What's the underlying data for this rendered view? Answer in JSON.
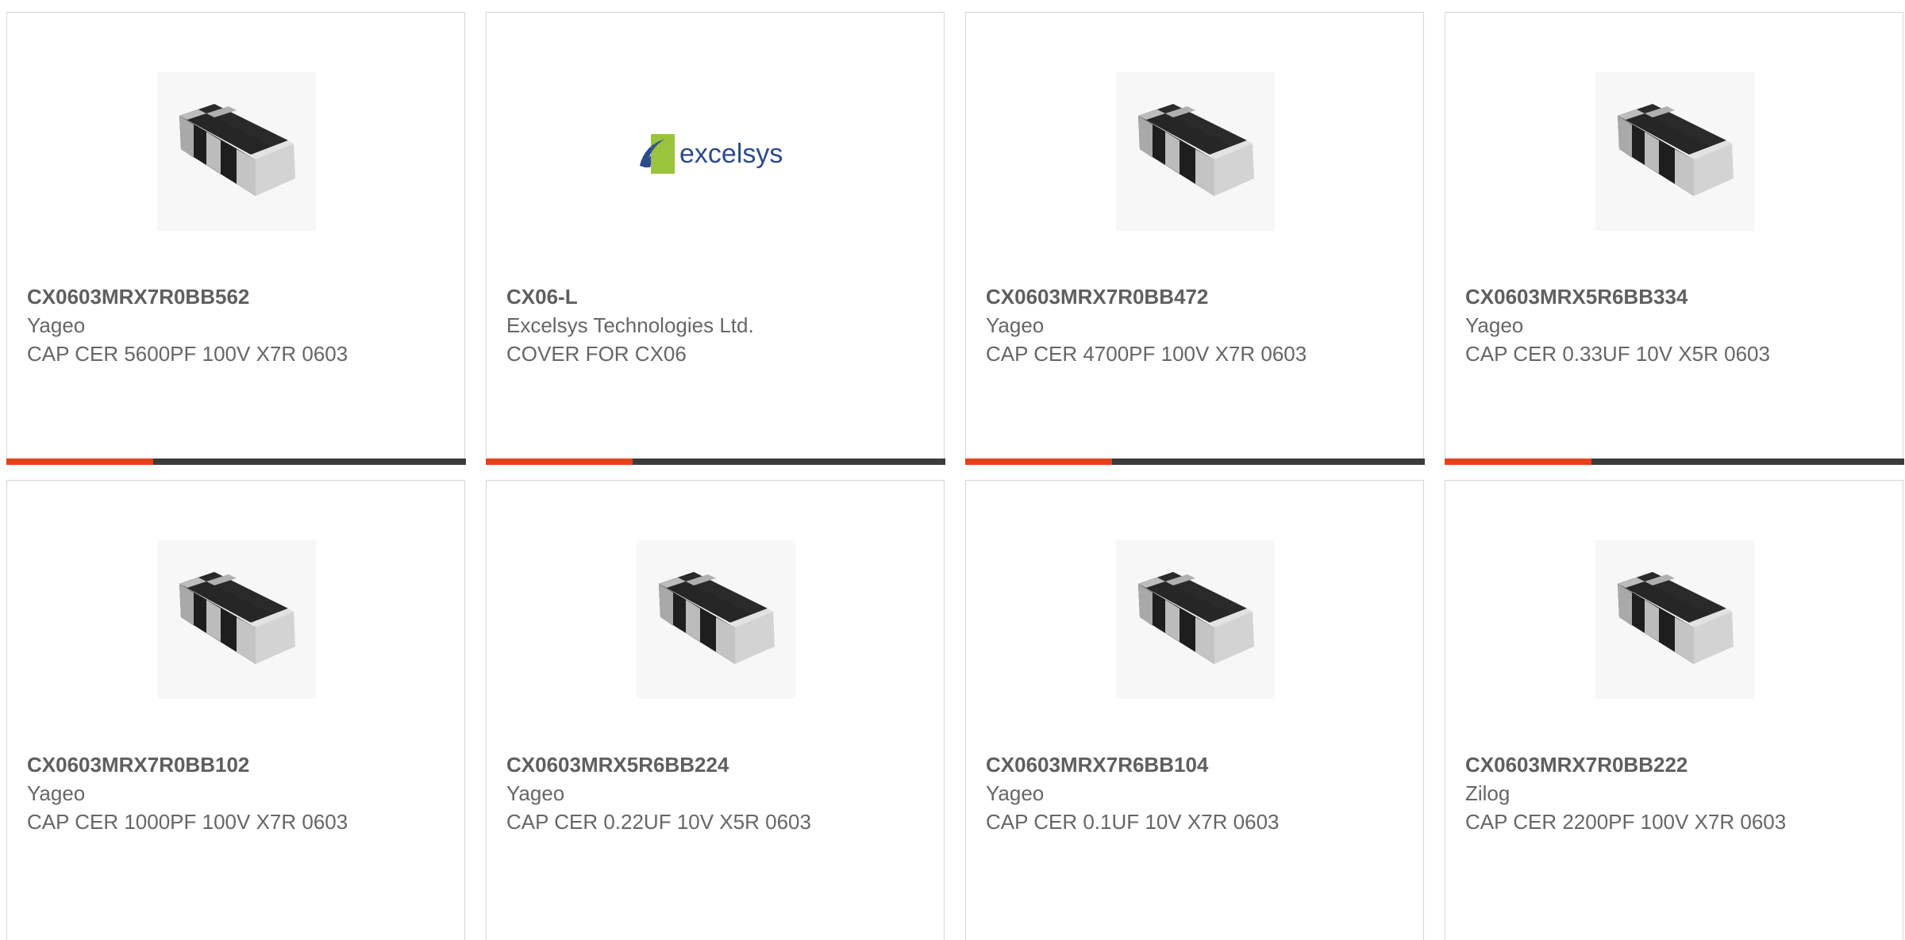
{
  "colors": {
    "accent": "#e8411a",
    "track": "#3c3c3c",
    "border": "#d6d6d6",
    "text": "#666666"
  },
  "products": [
    {
      "part_number": "CX0603MRX7R0BB562",
      "manufacturer": "Yageo",
      "description": "CAP CER 5600PF 100V X7R 0603",
      "image": "capacitor-chip-icon",
      "progress": 0.32
    },
    {
      "part_number": "CX06-L",
      "manufacturer": "Excelsys Technologies Ltd.",
      "description": "COVER FOR CX06",
      "image": "excelsys-logo",
      "logo_text": "excelsys",
      "progress": 0.32
    },
    {
      "part_number": "CX0603MRX7R0BB472",
      "manufacturer": "Yageo",
      "description": "CAP CER 4700PF 100V X7R 0603",
      "image": "capacitor-chip-icon",
      "progress": 0.32
    },
    {
      "part_number": "CX0603MRX5R6BB334",
      "manufacturer": "Yageo",
      "description": "CAP CER 0.33UF 10V X5R 0603",
      "image": "capacitor-chip-icon",
      "progress": 0.32
    },
    {
      "part_number": "CX0603MRX7R0BB102",
      "manufacturer": "Yageo",
      "description": "CAP CER 1000PF 100V X7R 0603",
      "image": "capacitor-chip-icon"
    },
    {
      "part_number": "CX0603MRX5R6BB224",
      "manufacturer": "Yageo",
      "description": "CAP CER 0.22UF 10V X5R 0603",
      "image": "capacitor-chip-icon"
    },
    {
      "part_number": "CX0603MRX7R6BB104",
      "manufacturer": "Yageo",
      "description": "CAP CER 0.1UF 10V X7R 0603",
      "image": "capacitor-chip-icon"
    },
    {
      "part_number": "CX0603MRX7R0BB222",
      "manufacturer": "Zilog",
      "description": "CAP CER 2200PF 100V X7R 0603",
      "image": "capacitor-chip-icon"
    }
  ]
}
